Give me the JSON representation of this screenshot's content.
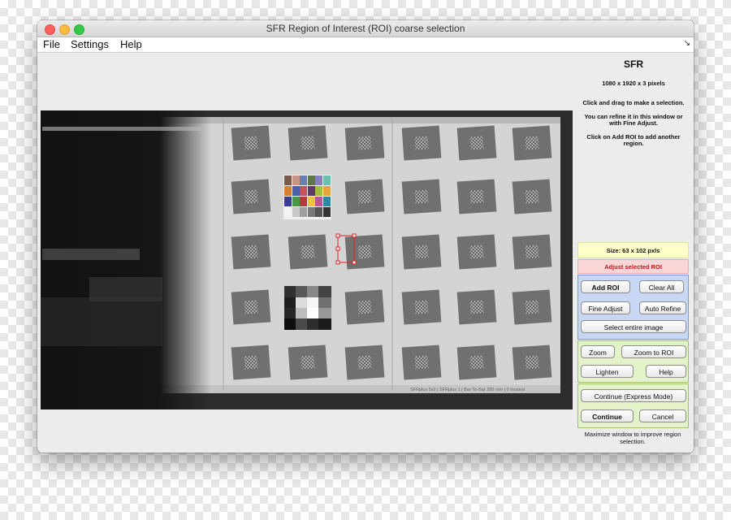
{
  "window": {
    "title": "SFR Region of Interest (ROI) coarse selection"
  },
  "menubar": {
    "items": [
      {
        "label": "File"
      },
      {
        "label": "Settings"
      },
      {
        "label": "Help"
      }
    ],
    "corner_glyph": "↘"
  },
  "panel": {
    "heading": "SFR",
    "dimensions": "1080 x 1920 x 3  pixels",
    "instructions": {
      "line1": "Click and drag to make a selection.",
      "line2": "You can refine it in this window or",
      "line3": "with Fine Adjust.",
      "line4": "Click on Add ROI to add another",
      "line5": "region."
    },
    "size_label": "Size:  63 x 102 pxls",
    "adjust_label": "Adjust selected ROI",
    "buttons": {
      "add_roi": "Add ROI",
      "clear_all": "Clear All",
      "fine_adjust": "Fine Adjust",
      "auto_refine": "Auto Refine",
      "select_entire": "Select entire image",
      "zoom": "Zoom",
      "zoom_to_roi": "Zoom to ROI",
      "lighten": "Lighten",
      "help": "Help",
      "continue_express": "Continue (Express Mode)",
      "continue": "Continue",
      "cancel": "Cancel"
    },
    "footer": {
      "line1": "Maximize window to improve region",
      "line2": "selection."
    }
  },
  "chart_image": {
    "caption": "SFRplus 5x9 | SFRplus 1 | Bar-To-Bar 285 mm | 0 Imatest"
  },
  "colors": {
    "panel_blue": "#c8d8f4",
    "panel_green": "#e4f2c8",
    "size_yellow": "#ffffc8",
    "adjust_pink": "#fbd6d6",
    "roi_red": "#e02020"
  }
}
